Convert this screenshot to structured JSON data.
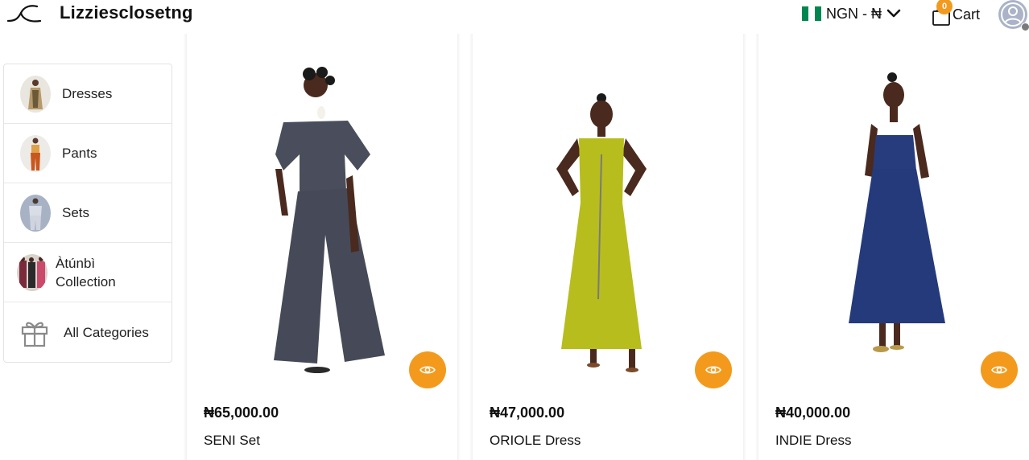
{
  "header": {
    "brand": "Lizziesclosetng",
    "currency_label": "NGN - ₦",
    "cart_count": "0",
    "cart_label": "Cart",
    "flag_colors": [
      "#008751",
      "#ffffff",
      "#008751"
    ]
  },
  "sidebar": {
    "items": [
      {
        "label": "Dresses",
        "icon": "dress-thumbnail"
      },
      {
        "label": "Pants",
        "icon": "pants-thumbnail"
      },
      {
        "label": "Sets",
        "icon": "sets-thumbnail"
      },
      {
        "label": "Àtúnbì Collection",
        "icon": "collection-thumbnail"
      },
      {
        "label": "All Categories",
        "icon": "gift-icon"
      }
    ]
  },
  "products": [
    {
      "price": "₦65,000.00",
      "name": "SENI Set",
      "garment_color": "#4a4e5c",
      "icon": "eye-icon"
    },
    {
      "price": "₦47,000.00",
      "name": "ORIOLE Dress",
      "garment_color": "#b7bd1c",
      "icon": "eye-icon"
    },
    {
      "price": "₦40,000.00",
      "name": "INDIE Dress",
      "garment_color": "#253a7a",
      "icon": "eye-icon"
    }
  ],
  "colors": {
    "accent": "#f39a1d",
    "skin": "#5a3a2a"
  }
}
